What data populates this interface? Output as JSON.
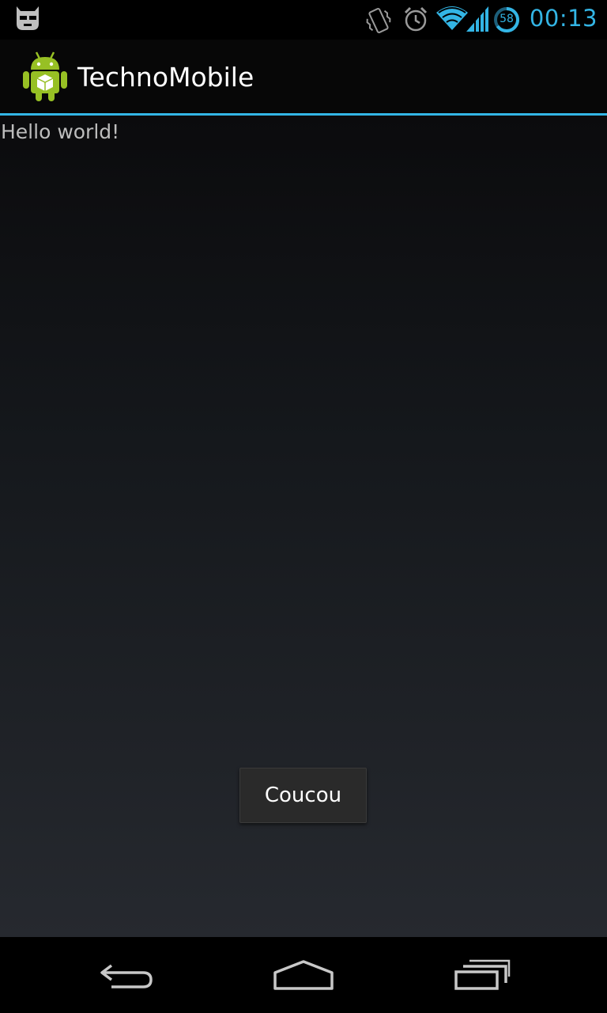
{
  "status_bar": {
    "left_icon": "cyanogen-icon",
    "icons": [
      "vibrate-icon",
      "alarm-icon",
      "wifi-icon",
      "signal-icon",
      "battery-icon"
    ],
    "battery_level": "58",
    "time": "00:13",
    "accent_color": "#33b5e5"
  },
  "action_bar": {
    "app_icon": "android-app-icon",
    "title": "TechnoMobile"
  },
  "main": {
    "text": "Hello world!"
  },
  "toast": {
    "text": "Coucou"
  },
  "nav_bar": {
    "buttons": [
      "back-icon",
      "home-icon",
      "recent-apps-icon"
    ]
  }
}
